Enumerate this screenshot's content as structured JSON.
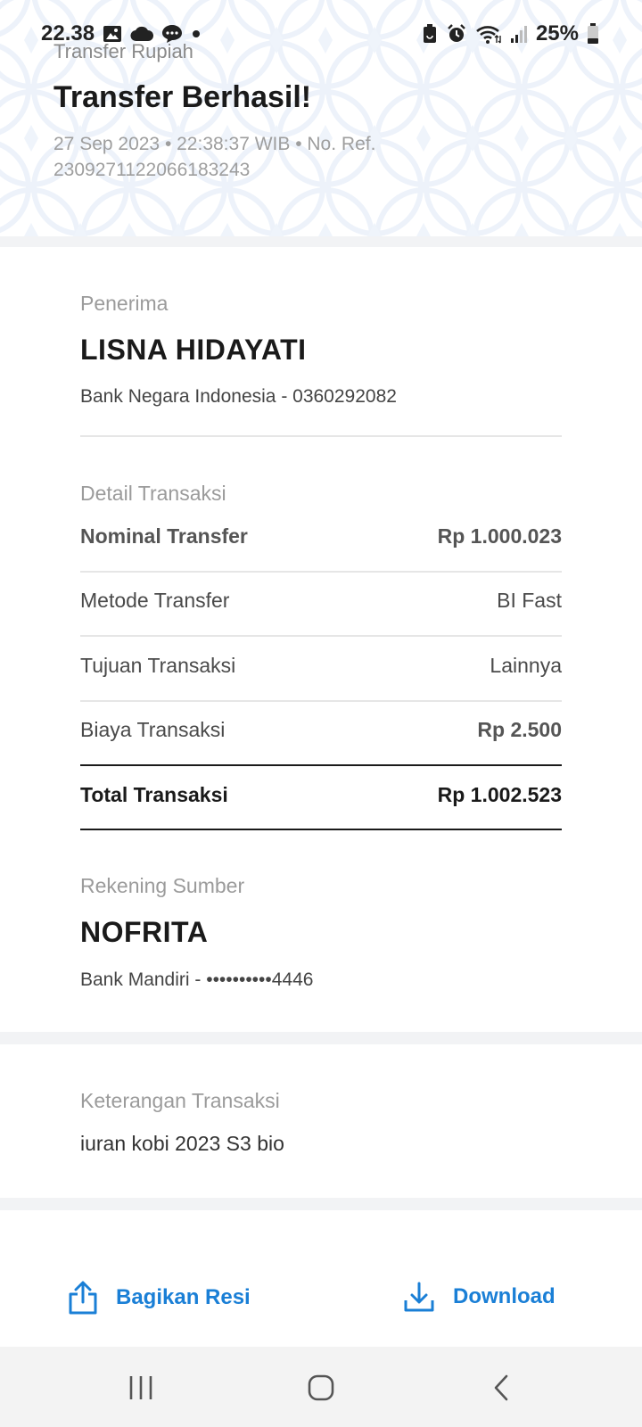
{
  "status_bar": {
    "time": "22.38",
    "battery_percent": "25%",
    "left_icons": [
      "gallery-icon",
      "cloud-icon",
      "chat-icon",
      "dot-icon"
    ],
    "right_icons": [
      "battery-saver-icon",
      "alarm-icon",
      "wifi-icon",
      "signal-icon",
      "battery-icon"
    ]
  },
  "header": {
    "subtitle": "Transfer Rupiah",
    "title": "Transfer Berhasil!",
    "meta_line1": "27 Sep 2023 • 22:38:37 WIB • No. Ref.",
    "meta_line2": "2309271122066183243"
  },
  "recipient": {
    "label": "Penerima",
    "name": "LISNA HIDAYATI",
    "bank_account": "Bank Negara Indonesia - 0360292082"
  },
  "transaction_detail": {
    "label": "Detail Transaksi",
    "rows": [
      {
        "label": "Nominal Transfer",
        "value": "Rp 1.000.023"
      },
      {
        "label": "Metode Transfer",
        "value": "BI Fast"
      },
      {
        "label": "Tujuan Transaksi",
        "value": "Lainnya"
      },
      {
        "label": "Biaya Transaksi",
        "value": "Rp 2.500"
      }
    ],
    "total_label": "Total Transaksi",
    "total_value": "Rp 1.002.523"
  },
  "source_account": {
    "label": "Rekening Sumber",
    "name": "NOFRITA",
    "bank_account": "Bank Mandiri - ••••••••••4446"
  },
  "note": {
    "label": "Keterangan Transaksi",
    "text": "iuran kobi 2023 S3 bio"
  },
  "actions": {
    "share_label": "Bagikan Resi",
    "download_label": "Download"
  },
  "colors": {
    "accent": "#1a7fd6",
    "pattern": "#dfe9f7",
    "separator": "#f2f3f5",
    "navbar": "#f3f3f3"
  }
}
